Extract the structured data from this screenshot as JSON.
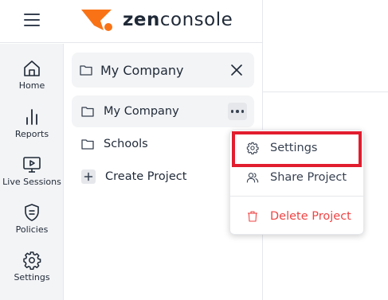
{
  "brand": {
    "logo_text_bold": "zen",
    "logo_text_rest": "console",
    "accent_color": "#f97316"
  },
  "rail": {
    "items": [
      {
        "label": "Home",
        "icon": "home-icon"
      },
      {
        "label": "Reports",
        "icon": "bar-chart-icon"
      },
      {
        "label": "Live Sessions",
        "icon": "monitor-play-icon"
      },
      {
        "label": "Policies",
        "icon": "shield-icon"
      },
      {
        "label": "Settings",
        "icon": "gear-icon"
      }
    ]
  },
  "panel": {
    "header_title": "My Company",
    "tree": [
      {
        "label": "My Company",
        "icon": "folder-icon",
        "active": true
      },
      {
        "label": "Schools",
        "icon": "folder-icon",
        "active": false
      },
      {
        "label": "Create Project",
        "icon": "plus-icon",
        "active": false
      }
    ]
  },
  "context_menu": {
    "items": [
      {
        "label": "Settings",
        "icon": "gear-icon",
        "highlighted": true
      },
      {
        "label": "Share Project",
        "icon": "users-icon"
      },
      {
        "label": "Delete Project",
        "icon": "trash-icon",
        "danger": true
      }
    ],
    "highlight_color": "#e11d2e",
    "danger_color": "#ef4444"
  }
}
